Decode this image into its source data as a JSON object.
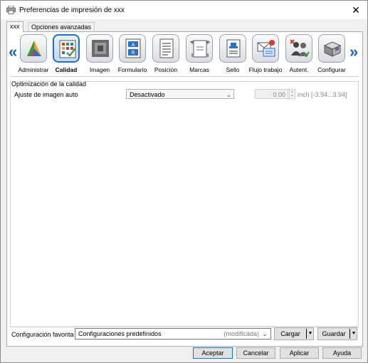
{
  "window": {
    "title": "Preferencias de impresión de xxx",
    "close_glyph": "✕"
  },
  "tabs": [
    {
      "label": "xxx",
      "active": true
    },
    {
      "label": "Opciones avanzadas",
      "active": false
    }
  ],
  "nav": {
    "prev_glyph": "«",
    "next_glyph": "»",
    "categories": [
      {
        "label": "Administrar",
        "icon": "color-triangle-icon",
        "active": false
      },
      {
        "label": "Calidad",
        "icon": "quality-grid-icon",
        "active": true
      },
      {
        "label": "Imagen",
        "icon": "image-icon",
        "active": false
      },
      {
        "label": "Formulario",
        "icon": "form-icon",
        "active": false
      },
      {
        "label": "Posición",
        "icon": "position-icon",
        "active": false
      },
      {
        "label": "Marcas",
        "icon": "marks-icon",
        "active": false
      },
      {
        "label": "Sello",
        "icon": "stamp-icon",
        "active": false
      },
      {
        "label": "Flujo trabajo",
        "icon": "workflow-icon",
        "active": false
      },
      {
        "label": "Autent.",
        "icon": "authentication-icon",
        "active": false
      },
      {
        "label": "Configurar",
        "icon": "configure-icon",
        "active": false
      }
    ]
  },
  "quality": {
    "group_title": "Optimización de la calidad",
    "auto_image_label": "Ajuste de imagen auto",
    "auto_image_value": "Desactivado",
    "offset_value": "0.00",
    "offset_unit": "inch [-3.94...3.94]"
  },
  "favorites": {
    "label": "Configuración favorita",
    "value": "Configuraciones predefinidos",
    "modified": "(modificada)",
    "load_label": "Cargar",
    "save_label": "Guardar"
  },
  "buttons": {
    "ok": "Aceptar",
    "cancel": "Cancelar",
    "apply": "Aplicar",
    "help": "Ayuda"
  },
  "colors": {
    "accent": "#1f6fc9",
    "nav_arrow": "#1e63c4"
  }
}
